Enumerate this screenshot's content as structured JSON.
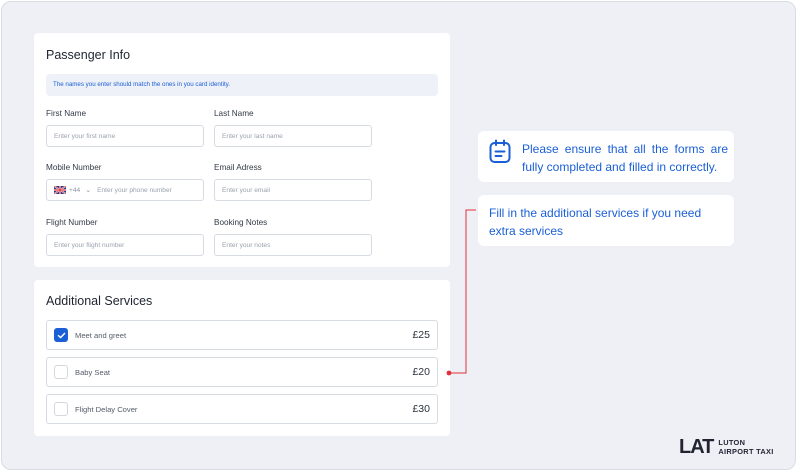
{
  "passenger": {
    "title": "Passenger Info",
    "notice": "The names you enter should match the ones in you card identity.",
    "first_name": {
      "label": "First Name",
      "placeholder": "Enter your first name"
    },
    "last_name": {
      "label": "Last Name",
      "placeholder": "Enter your last name"
    },
    "mobile": {
      "label": "Mobile Number",
      "country_code": "+44",
      "placeholder": "Enter your phone number",
      "flag_icon": "uk-flag-icon"
    },
    "email": {
      "label": "Email Adress",
      "placeholder": "Enter your email"
    },
    "flight": {
      "label": "Flight Number",
      "placeholder": "Enter your flight number"
    },
    "notes": {
      "label": "Booking Notes",
      "placeholder": "Enter your notes"
    }
  },
  "services": {
    "title": "Additional Services",
    "items": [
      {
        "name": "Meet and greet",
        "price": "£25",
        "checked": true
      },
      {
        "name": "Baby Seat",
        "price": "£20",
        "checked": false
      },
      {
        "name": "Flight Delay Cover",
        "price": "£30",
        "checked": false
      }
    ]
  },
  "tips": {
    "forms": "Please ensure that all the forms are fully completed and filled in correctly.",
    "services": "Fill in the additional services if you need extra services"
  },
  "logo": {
    "mark": "LAT",
    "line1": "LUTON",
    "line2": "AIRPORT TAXI"
  },
  "colors": {
    "accent": "#1a5fd6",
    "connector": "#e0313b"
  }
}
